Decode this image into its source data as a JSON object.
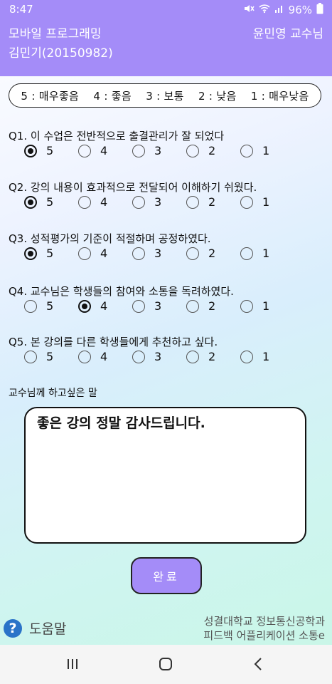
{
  "status": {
    "time": "8:47",
    "battery": "96%"
  },
  "header": {
    "course": "모바일 프로그래밍",
    "professor": "윤민영 교수님",
    "student": "김민기(20150982)"
  },
  "scale_text": "5 : 매우좋음    4 : 좋음    3 : 보통    2 : 낮음    1 : 매우낮음",
  "questions": [
    {
      "text": "Q1. 이 수업은 전반적으로 출결관리가 잘 되었다",
      "options": [
        "5",
        "4",
        "3",
        "2",
        "1"
      ],
      "selected": "5"
    },
    {
      "text": "Q2. 강의 내용이 효과적으로 전달되어 이해하기 쉬웠다.",
      "options": [
        "5",
        "4",
        "3",
        "2",
        "1"
      ],
      "selected": "5"
    },
    {
      "text": "Q3. 성적평가의 기준이 적절하며 공정하였다.",
      "options": [
        "5",
        "4",
        "3",
        "2",
        "1"
      ],
      "selected": "5"
    },
    {
      "text": "Q4. 교수님은 학생들의 참여와 소통을 독려하였다.",
      "options": [
        "5",
        "4",
        "3",
        "2",
        "1"
      ],
      "selected": "4"
    },
    {
      "text": "Q5. 본 강의를 다른 학생들에게 추천하고 싶다.",
      "options": [
        "5",
        "4",
        "3",
        "2",
        "1"
      ],
      "selected": null
    }
  ],
  "comment": {
    "label": "교수님께 하고싶은 말",
    "value": "좋은 강의 정말 감사드립니다."
  },
  "submit_label": "완료",
  "help_label": "도움말",
  "credit": {
    "line1": "성결대학교 정보통신공학과",
    "line2": "피드백 어플리케이션 소통e"
  },
  "icons": {
    "help": "help-icon",
    "nav": [
      "recent-apps-icon",
      "home-icon",
      "back-icon"
    ]
  },
  "colors": {
    "accent": "#a48cf8",
    "help_icon": "#2a73c8"
  }
}
